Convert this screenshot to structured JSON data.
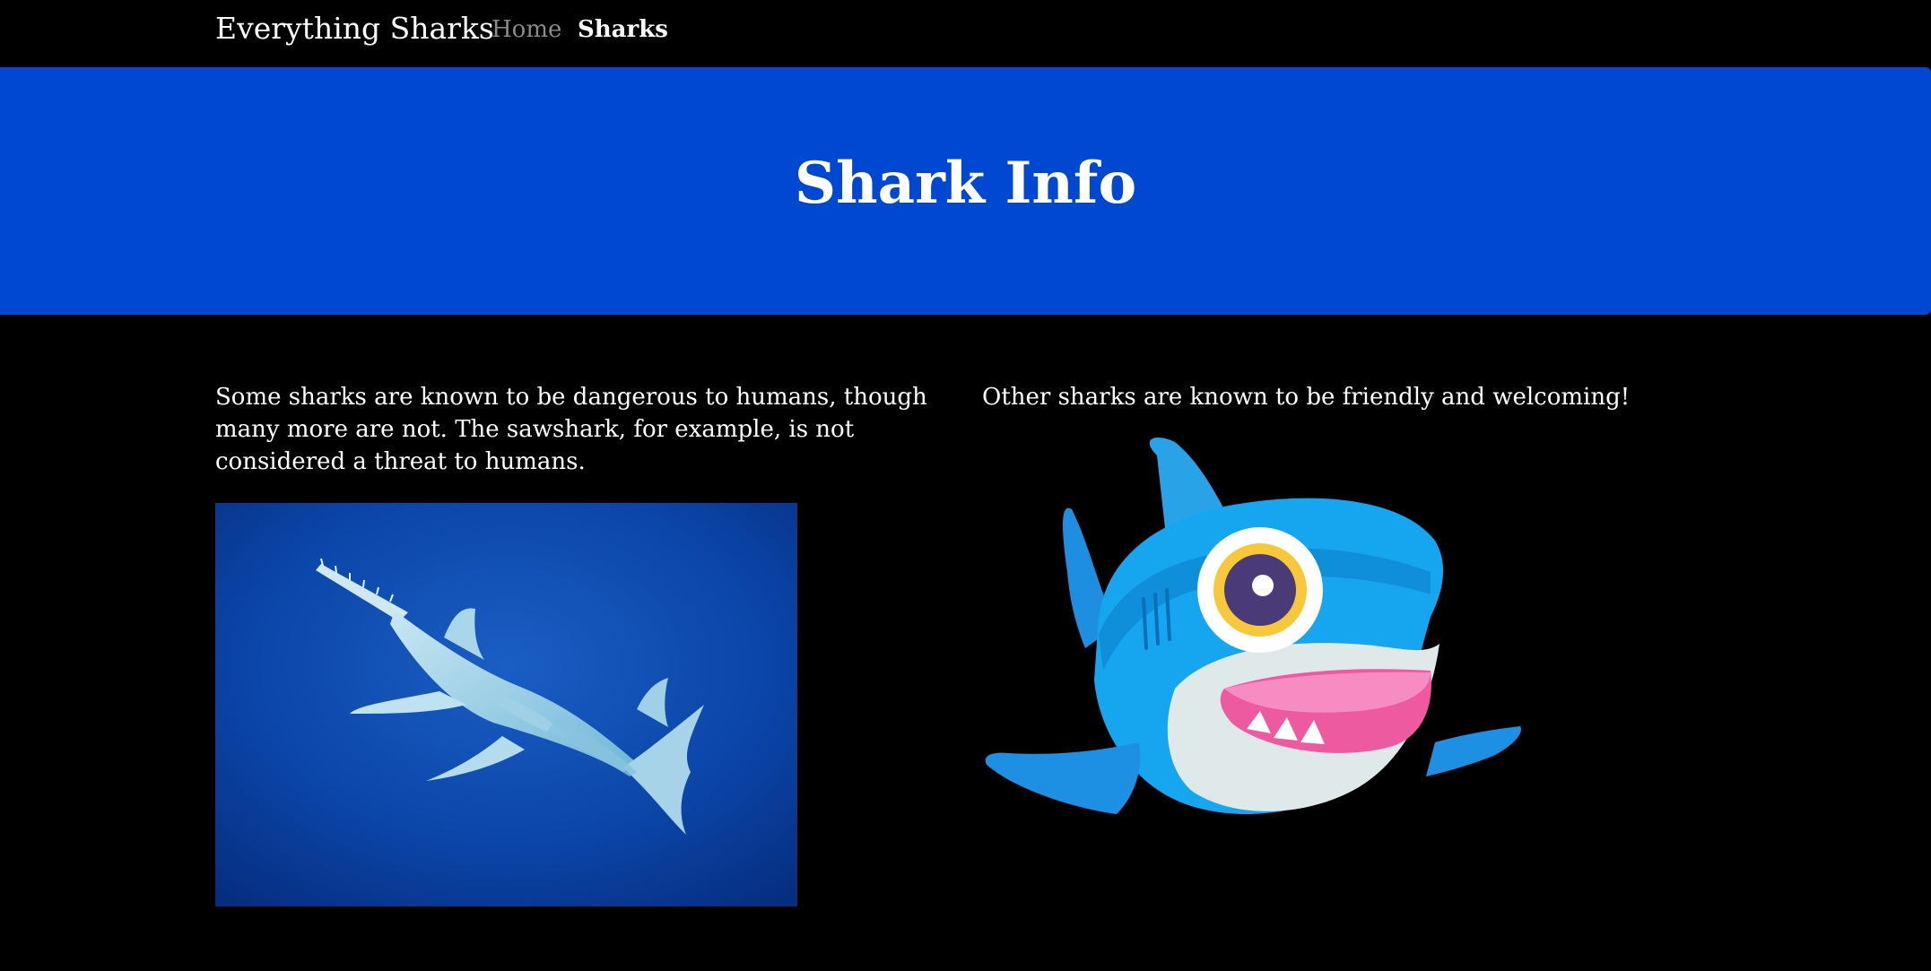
{
  "navbar": {
    "brand": "Everything Sharks",
    "links": [
      {
        "label": "Home"
      },
      {
        "label": "Sharks"
      }
    ]
  },
  "jumbotron": {
    "title": "Shark Info"
  },
  "content": {
    "left_paragraph": "Some sharks are known to be dangerous to humans, though many more are not. The sawshark, for example, is not considered a threat to humans.",
    "right_paragraph": "Other sharks are known to be friendly and welcoming!"
  },
  "colors": {
    "background": "#000000",
    "jumbotron": "#0047d1",
    "nav_inactive": "#8a8a8a",
    "text": "#ffffff"
  }
}
